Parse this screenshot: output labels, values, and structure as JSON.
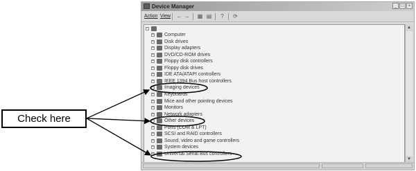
{
  "window": {
    "title": "Device Manager",
    "menu": [
      "Action",
      "View"
    ],
    "toolbar_icons": [
      "back-icon",
      "forward-icon",
      "properties-icon",
      "print-icon",
      "help-icon",
      "refresh-icon"
    ]
  },
  "tree": {
    "items": [
      {
        "label": "Computer",
        "highlighted": false
      },
      {
        "label": "Disk drives",
        "highlighted": false
      },
      {
        "label": "Display adapters",
        "highlighted": false
      },
      {
        "label": "DVD/CD-ROM drives",
        "highlighted": false
      },
      {
        "label": "Floppy disk controllers",
        "highlighted": false
      },
      {
        "label": "Floppy disk drives",
        "highlighted": false
      },
      {
        "label": "IDE ATA/ATAPI controllers",
        "highlighted": false
      },
      {
        "label": "IEEE 1394 Bus host controllers",
        "highlighted": false
      },
      {
        "label": "Imaging devices",
        "highlighted": true
      },
      {
        "label": "Keyboards",
        "highlighted": false
      },
      {
        "label": "Mice and other pointing devices",
        "highlighted": false
      },
      {
        "label": "Monitors",
        "highlighted": false
      },
      {
        "label": "Network adapters",
        "highlighted": false
      },
      {
        "label": "Other devices",
        "highlighted": true
      },
      {
        "label": "Ports (COM & LPT)",
        "highlighted": false
      },
      {
        "label": "SCSI and RAID controllers",
        "highlighted": false
      },
      {
        "label": "Sound, video and game controllers",
        "highlighted": false
      },
      {
        "label": "System devices",
        "highlighted": false
      },
      {
        "label": "Universal Serial Bus controllers",
        "highlighted": true
      }
    ]
  },
  "callout": {
    "text": "Check here"
  }
}
